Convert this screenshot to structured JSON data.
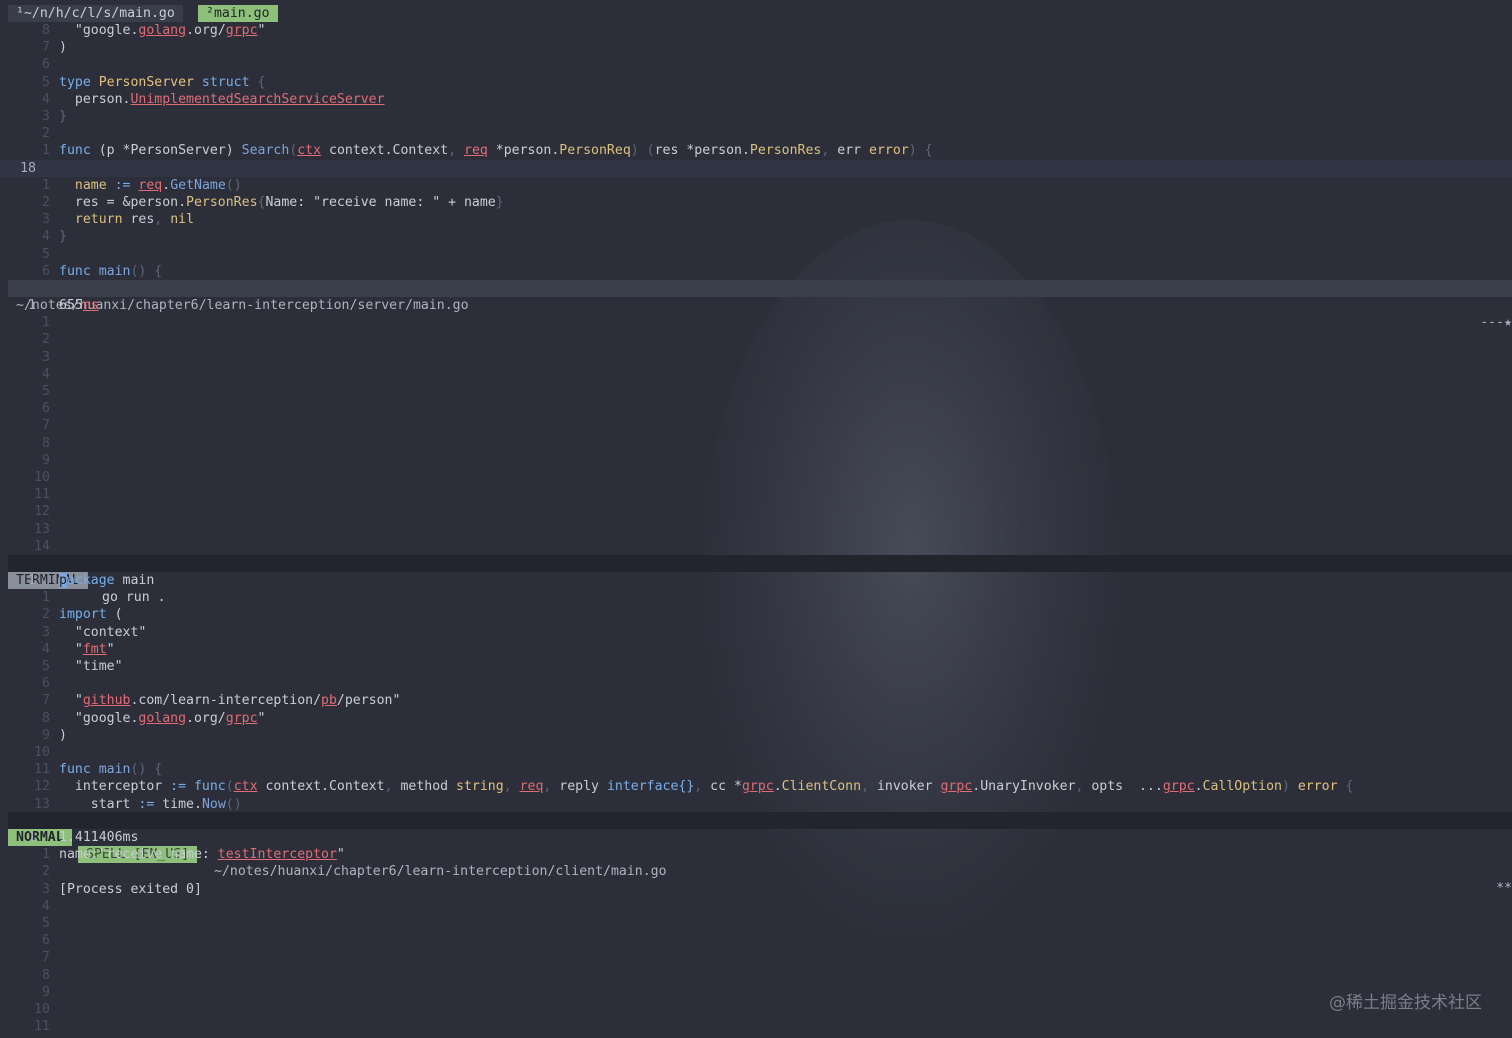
{
  "tabline": {
    "tab1": "¹~/n/h/c/l/s/main.go",
    "tab2": "²main.go"
  },
  "pane1": {
    "lines": [
      {
        "n": "8",
        "parts": [
          [
            "  ",
            ""
          ],
          [
            "\"google.",
            ""
          ],
          [
            "golang",
            "und"
          ],
          [
            ".org/",
            ""
          ],
          [
            "grpc",
            "und"
          ],
          [
            "\"",
            ""
          ]
        ]
      },
      {
        "n": "7",
        "parts": [
          [
            ")",
            ""
          ]
        ]
      },
      {
        "n": "6",
        "parts": []
      },
      {
        "n": "5",
        "parts": [
          [
            "type ",
            "kw"
          ],
          [
            "PersonServer ",
            "ty"
          ],
          [
            "struct ",
            "kw"
          ],
          [
            "{",
            "punc"
          ]
        ]
      },
      {
        "n": "4",
        "parts": [
          [
            "  person.",
            ""
          ],
          [
            "UnimplementedSearchServiceServer",
            "und2"
          ]
        ]
      },
      {
        "n": "3",
        "parts": [
          [
            "}",
            "punc"
          ]
        ]
      },
      {
        "n": "2",
        "parts": []
      },
      {
        "n": "1",
        "parts": [
          [
            "func ",
            "kw"
          ],
          [
            "(p *",
            ""
          ],
          [
            "PersonServer",
            ""
          ],
          [
            ") ",
            ""
          ],
          [
            "Search",
            "fn"
          ],
          [
            "(",
            "punc"
          ],
          [
            "ctx",
            "und"
          ],
          [
            " context.Context",
            ""
          ],
          [
            ", ",
            "punc"
          ],
          [
            "req",
            "und"
          ],
          [
            " *person.",
            ""
          ],
          [
            "PersonReq",
            "pk"
          ],
          [
            ") ",
            "punc"
          ],
          [
            "(",
            "punc"
          ],
          [
            "res *person.",
            ""
          ],
          [
            "PersonRes",
            "pk"
          ],
          [
            ", ",
            "punc"
          ],
          [
            "err ",
            ""
          ],
          [
            "error",
            "ty"
          ],
          [
            ") {",
            "punc"
          ]
        ]
      },
      {
        "n": "18",
        "cur": true,
        "parts": []
      },
      {
        "n": "1",
        "parts": [
          [
            "  name ",
            "pk"
          ],
          [
            ":= ",
            "kw"
          ],
          [
            "req",
            "und"
          ],
          [
            ".",
            ""
          ],
          [
            "GetName",
            "fn"
          ],
          [
            "()",
            "punc"
          ]
        ]
      },
      {
        "n": "2",
        "parts": [
          [
            "  res = &person.",
            ""
          ],
          [
            "PersonRes",
            "pk"
          ],
          [
            "{",
            "punc"
          ],
          [
            "Name: \"receive name: \" + name",
            ""
          ],
          [
            "}",
            "punc"
          ]
        ]
      },
      {
        "n": "3",
        "parts": [
          [
            "  return ",
            "pk"
          ],
          [
            "res",
            ""
          ],
          [
            ", ",
            "punc"
          ],
          [
            "nil",
            "pk"
          ]
        ]
      },
      {
        "n": "4",
        "parts": [
          [
            "}",
            "punc"
          ]
        ]
      },
      {
        "n": "5",
        "parts": []
      },
      {
        "n": "6",
        "parts": [
          [
            "func ",
            "kw"
          ],
          [
            "main",
            "fn"
          ],
          [
            "() {",
            "punc"
          ]
        ]
      }
    ]
  },
  "status1": {
    "path": "~/notes/huanxi/chapter6/learn-interception/server/main.go",
    "right": "---★"
  },
  "pane2": {
    "lines": [
      {
        "n": "1",
        "cur": true,
        "parts": [
          [
            "655",
            ""
          ],
          [
            "ns",
            "und"
          ]
        ]
      },
      {
        "n": "1",
        "parts": []
      },
      {
        "n": "2",
        "parts": []
      },
      {
        "n": "3",
        "parts": []
      },
      {
        "n": "4",
        "parts": []
      },
      {
        "n": "5",
        "parts": []
      },
      {
        "n": "6",
        "parts": []
      },
      {
        "n": "7",
        "parts": []
      },
      {
        "n": "8",
        "parts": []
      },
      {
        "n": "9",
        "parts": []
      },
      {
        "n": "10",
        "parts": []
      },
      {
        "n": "11",
        "parts": []
      },
      {
        "n": "12",
        "parts": []
      },
      {
        "n": "13",
        "parts": []
      },
      {
        "n": "14",
        "parts": []
      }
    ]
  },
  "status2": {
    "mode": "TERMINAL",
    "text": "go run ."
  },
  "pane3": {
    "lines": [
      {
        "n": "1",
        "cur": true,
        "parts": [
          [
            "p",
            "cursor"
          ],
          [
            "ackage ",
            "kw"
          ],
          [
            "main",
            ""
          ]
        ]
      },
      {
        "n": "1",
        "parts": []
      },
      {
        "n": "2",
        "parts": [
          [
            "import ",
            "kw"
          ],
          [
            "(",
            ""
          ]
        ]
      },
      {
        "n": "3",
        "parts": [
          [
            "  \"context\"",
            ""
          ]
        ]
      },
      {
        "n": "4",
        "parts": [
          [
            "  \"",
            ""
          ],
          [
            "fmt",
            "und"
          ],
          [
            "\"",
            ""
          ]
        ]
      },
      {
        "n": "5",
        "parts": [
          [
            "  \"time\"",
            ""
          ]
        ]
      },
      {
        "n": "6",
        "parts": []
      },
      {
        "n": "7",
        "parts": [
          [
            "  \"",
            ""
          ],
          [
            "github",
            "und"
          ],
          [
            ".com/learn-interception/",
            ""
          ],
          [
            "pb",
            "und"
          ],
          [
            "/person\"",
            ""
          ]
        ]
      },
      {
        "n": "8",
        "parts": [
          [
            "  \"google.",
            ""
          ],
          [
            "golang",
            "und"
          ],
          [
            ".org/",
            ""
          ],
          [
            "grpc",
            "und"
          ],
          [
            "\"",
            ""
          ]
        ]
      },
      {
        "n": "9",
        "parts": [
          [
            ")",
            ""
          ]
        ]
      },
      {
        "n": "10",
        "parts": []
      },
      {
        "n": "11",
        "parts": [
          [
            "func ",
            "kw"
          ],
          [
            "main",
            "fn"
          ],
          [
            "() {",
            "punc"
          ]
        ]
      },
      {
        "n": "12",
        "parts": [
          [
            "  interceptor ",
            ""
          ],
          [
            ":= ",
            "kw"
          ],
          [
            "func",
            "kw"
          ],
          [
            "(",
            "punc"
          ],
          [
            "ctx",
            "und"
          ],
          [
            " context.Context",
            ""
          ],
          [
            ", ",
            "punc"
          ],
          [
            "method ",
            ""
          ],
          [
            "string",
            "ty"
          ],
          [
            ", ",
            "punc"
          ],
          [
            "req",
            "und"
          ],
          [
            ", ",
            "punc"
          ],
          [
            "reply ",
            ""
          ],
          [
            "interface{}",
            "kw"
          ],
          [
            ", ",
            "punc"
          ],
          [
            "cc *",
            ""
          ],
          [
            "grpc",
            "und"
          ],
          [
            ".",
            ""
          ],
          [
            "ClientConn",
            "pk"
          ],
          [
            ", ",
            "punc"
          ],
          [
            "invoker ",
            ""
          ],
          [
            "grpc",
            "und"
          ],
          [
            ".UnaryInvoker",
            ""
          ],
          [
            ", ",
            "punc"
          ],
          [
            "opts  ...",
            ""
          ],
          [
            "grpc",
            "und"
          ],
          [
            ".",
            ""
          ],
          [
            "CallOption",
            "pk"
          ],
          [
            ") ",
            "punc"
          ],
          [
            "error ",
            "ty"
          ],
          [
            "{",
            "punc"
          ]
        ]
      },
      {
        "n": "13",
        "parts": [
          [
            "    start ",
            ""
          ],
          [
            ":= ",
            "kw"
          ],
          [
            "time.",
            ""
          ],
          [
            "Now",
            "fn"
          ],
          [
            "()",
            "punc"
          ]
        ]
      }
    ]
  },
  "status3": {
    "mode": "NORMAL",
    "spell": "SPELL [EN_US]",
    "path": "~/notes/huanxi/chapter6/learn-interception/client/main.go",
    "right": "**"
  },
  "pane4": {
    "lines": [
      {
        "n": "1",
        "cur": true,
        "parts": [
          [
            "1.411406ms",
            ""
          ]
        ]
      },
      {
        "n": "1",
        "parts": [
          [
            "name:\"receive name: ",
            ""
          ],
          [
            "testInterceptor",
            "und"
          ],
          [
            "\"",
            ""
          ]
        ]
      },
      {
        "n": "2",
        "parts": []
      },
      {
        "n": "3",
        "parts": [
          [
            "[Process exited 0]",
            ""
          ]
        ]
      },
      {
        "n": "4",
        "parts": []
      },
      {
        "n": "5",
        "parts": []
      },
      {
        "n": "6",
        "parts": []
      },
      {
        "n": "7",
        "parts": []
      },
      {
        "n": "8",
        "parts": []
      },
      {
        "n": "9",
        "parts": []
      },
      {
        "n": "10",
        "parts": []
      },
      {
        "n": "11",
        "parts": []
      }
    ]
  },
  "watermark": "@稀土掘金技术社区",
  "colors": {
    "background": "#2c2f3a",
    "keyword": "#78aee8",
    "type": "#e5c07b",
    "spell_error": "#e06c75",
    "status_bar": "#3b3f4c",
    "tab_active": "#8ec07c"
  }
}
